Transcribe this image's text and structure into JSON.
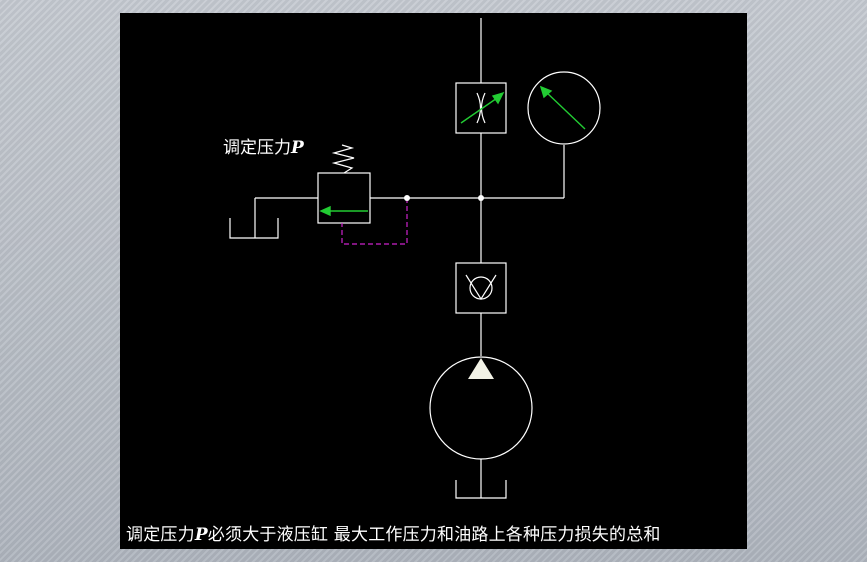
{
  "diagram": {
    "relief_label": "调定压力",
    "relief_label_var": "P",
    "components": [
      "throttle-valve",
      "pressure-gauge",
      "relief-valve",
      "check-valve",
      "hydraulic-pump",
      "tank"
    ]
  },
  "caption": {
    "before": "调定压力",
    "var": "P",
    "after": "必须大于液压缸 最大工作压力和油路上各种压力损失的总和"
  },
  "colors": {
    "background": "#000000",
    "lines": "#ffffff",
    "arrows": "#22cc33",
    "pilot_line": "#cc22cc",
    "frame": "#b9bec6"
  }
}
